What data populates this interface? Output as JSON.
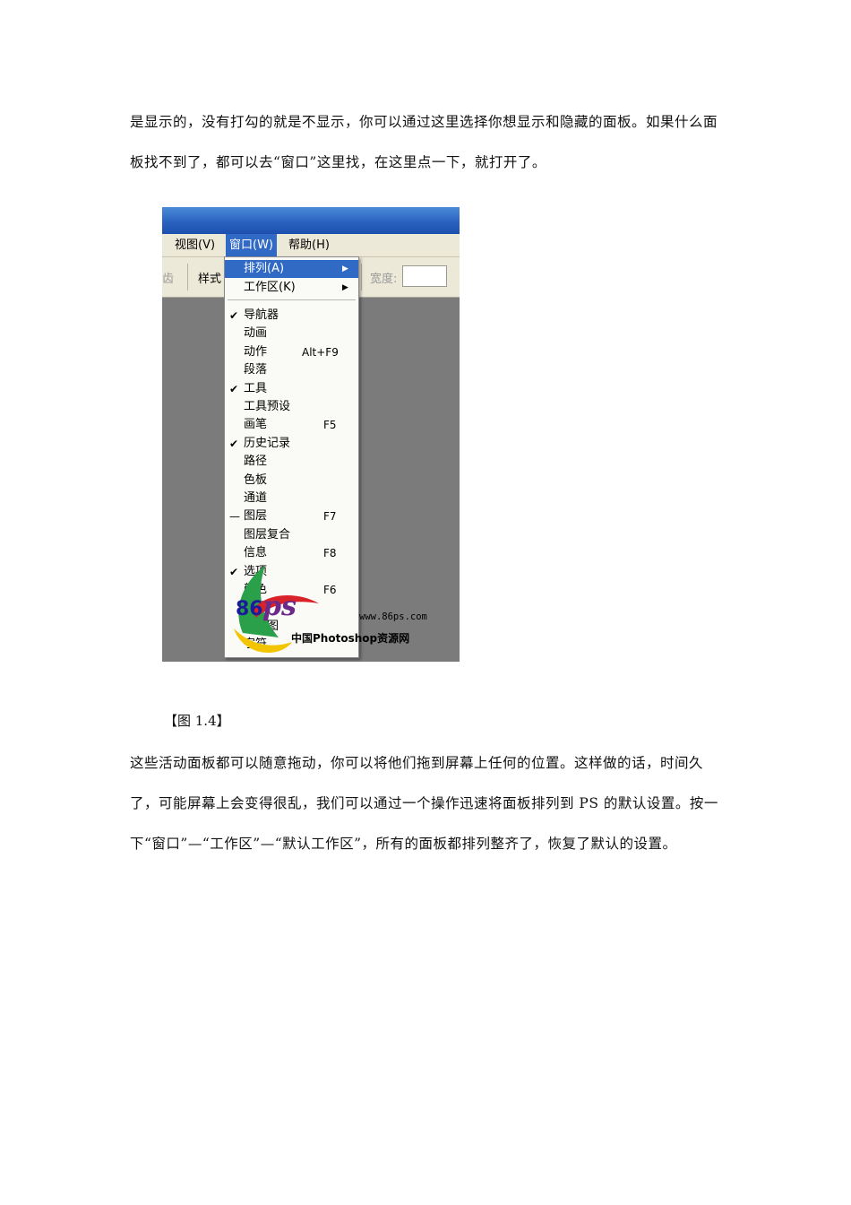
{
  "paragraph1": "是显示的，没有打勾的就是不显示，你可以通过这里选择你想显示和隐藏的面板。如果什么面板找不到了，都可以去“窗口”这里找，在这里点一下，就打开了。",
  "screenshot": {
    "menubar": {
      "view": "视图(V)",
      "window": "窗口(W)",
      "help": "帮助(H)"
    },
    "toolbar": {
      "antialias_partial": "齿",
      "style": "样式",
      "width": "宽度:"
    },
    "menu": {
      "arrange": "排列(A)",
      "workspace": "工作区(K)",
      "items": [
        {
          "label": "导航器",
          "shortcut": "",
          "mark": "✔"
        },
        {
          "label": "动画",
          "shortcut": "",
          "mark": ""
        },
        {
          "label": "动作",
          "shortcut": "Alt+F9",
          "mark": ""
        },
        {
          "label": "段落",
          "shortcut": "",
          "mark": ""
        },
        {
          "label": "工具",
          "shortcut": "",
          "mark": "✔"
        },
        {
          "label": "工具预设",
          "shortcut": "",
          "mark": ""
        },
        {
          "label": "画笔",
          "shortcut": "F5",
          "mark": ""
        },
        {
          "label": "历史记录",
          "shortcut": "",
          "mark": "✔"
        },
        {
          "label": "路径",
          "shortcut": "",
          "mark": ""
        },
        {
          "label": "色板",
          "shortcut": "",
          "mark": ""
        },
        {
          "label": "通道",
          "shortcut": "",
          "mark": ""
        },
        {
          "label": "图层",
          "shortcut": "F7",
          "mark": "—"
        },
        {
          "label": "图层复合",
          "shortcut": "",
          "mark": ""
        },
        {
          "label": "信息",
          "shortcut": "F8",
          "mark": ""
        },
        {
          "label": "选项",
          "shortcut": "",
          "mark": "✔"
        },
        {
          "label": "颜色",
          "shortcut": "F6",
          "mark": ""
        },
        {
          "label": "样式",
          "shortcut": "",
          "mark": ""
        },
        {
          "label": "直方图",
          "shortcut": "",
          "mark": ""
        },
        {
          "label": "字符",
          "shortcut": "",
          "mark": ""
        }
      ]
    },
    "watermark": {
      "num": "86",
      "ps": "ps",
      "url": "www.86ps.com",
      "name": "中国Photoshop资源网"
    }
  },
  "caption": "【图 1.4】",
  "paragraph2": "这些活动面板都可以随意拖动，你可以将他们拖到屏幕上任何的位置。这样做的话，时间久了，可能屏幕上会变得很乱，我们可以通过一个操作迅速将面板排列到 PS 的默认设置。按一下“窗口”—“工作区”—“默认工作区”，所有的面板都排列整齐了，恢复了默认的设置。",
  "colors": {
    "menu_highlight": "#316ac5",
    "titlebar": "#2a62c0",
    "canvas": "#7b7b7b"
  }
}
